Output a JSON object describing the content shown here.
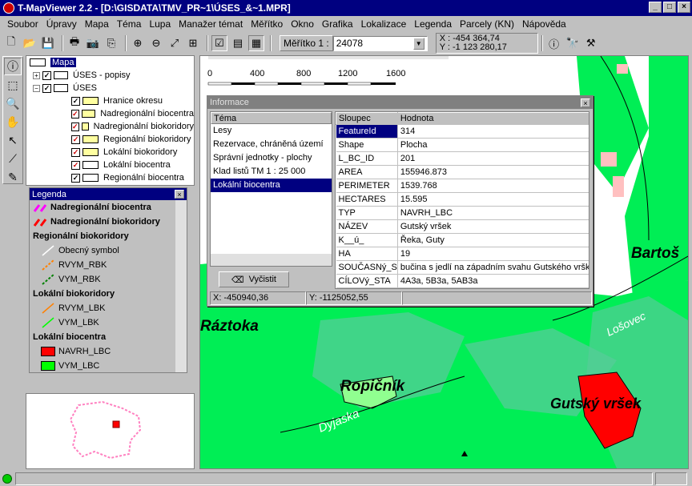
{
  "window": {
    "title": "T-MapViewer 2.2 - [D:\\GISDATA\\TMV_PR~1\\ÚSES_&~1.MPR]"
  },
  "menu": [
    "Soubor",
    "Úpravy",
    "Mapa",
    "Téma",
    "Lupa",
    "Manažer témat",
    "Měřítko",
    "Okno",
    "Grafika",
    "Lokalizace",
    "Legenda",
    "Parcely (KN)",
    "Nápověda"
  ],
  "toolbar": {
    "scale_label": "Měřítko 1 :",
    "scale_value": "24078",
    "coord_x": "X : -454 364,74",
    "coord_y": "Y : -1 123 280,17"
  },
  "tree": {
    "root": "Mapa",
    "groups": [
      "ÚSES - popisy",
      "ÚSES"
    ],
    "layers": [
      "Hranice okresu",
      "Nadregionální biocentra",
      "Nadregionální biokoridory",
      "Regionální biokoridory",
      "Lokální biokoridory",
      "Lokální biocentra",
      "Regionální biocentra"
    ]
  },
  "legend": {
    "title": "Legenda",
    "items": [
      {
        "label": "Nadregionální biocentra",
        "kind": "heading",
        "color": "#ff00ff"
      },
      {
        "label": "Nadregionální biokoridory",
        "kind": "heading",
        "color": "#ff0000"
      },
      {
        "label": "Regionální biokoridory",
        "kind": "group"
      },
      {
        "label": "Obecný symbol",
        "kind": "line",
        "color": "#ffffff"
      },
      {
        "label": "RVYM_RBK",
        "kind": "line",
        "color": "#ff8000"
      },
      {
        "label": "VYM_RBK",
        "kind": "line",
        "color": "#008000"
      },
      {
        "label": "Lokální biokoridory",
        "kind": "group"
      },
      {
        "label": "RVYM_LBK",
        "kind": "line",
        "color": "#ff8000"
      },
      {
        "label": "VYM_LBK",
        "kind": "line",
        "color": "#00ff00"
      },
      {
        "label": "Lokální biocentra",
        "kind": "group"
      },
      {
        "label": "NAVRH_LBC",
        "kind": "fill",
        "color": "#ff0000"
      },
      {
        "label": "VYM_LBC",
        "kind": "fill",
        "color": "#00ff00"
      }
    ]
  },
  "map": {
    "scalebar": [
      "0",
      "400",
      "800",
      "1200",
      "1600"
    ],
    "labels": {
      "raztoka": "Ráztoka",
      "ropicnik": "Ropičník",
      "gutsky": "Gutský vršek",
      "bartos": "Bartoš",
      "dyjaska": "Dyjaska",
      "losovec": "Lošovec"
    }
  },
  "info": {
    "title": "Informace",
    "theme_header": "Téma",
    "themes": [
      "Lesy",
      "Rezervace, chráněná území",
      "Správní jednotky - plochy",
      "Klad listů TM 1 : 25 000",
      "Lokální biocentra"
    ],
    "selected_theme": "Lokální biocentra",
    "clear_label": "Vyčistit",
    "col_field": "Sloupec",
    "col_value": "Hodnota",
    "rows": [
      {
        "k": "FeatureId",
        "v": "314"
      },
      {
        "k": "Shape",
        "v": "Plocha"
      },
      {
        "k": "L_BC_ID",
        "v": "201"
      },
      {
        "k": "AREA",
        "v": "155946.873"
      },
      {
        "k": "PERIMETER",
        "v": "1539.768"
      },
      {
        "k": "HECTARES",
        "v": "15.595"
      },
      {
        "k": "TYP",
        "v": "NAVRH_LBC"
      },
      {
        "k": "NÁZEV",
        "v": "Gutský vršek"
      },
      {
        "k": "K__ú_",
        "v": "Řeka, Guty"
      },
      {
        "k": "HA",
        "v": "19"
      },
      {
        "k": "SOUČASNý_S",
        "v": "bučina s jedlí na západním svahu Gutského vršku"
      },
      {
        "k": "CÍLOVý_STA",
        "v": "4A3a, 5B3a, 5AB3a"
      }
    ],
    "status_x": "X: -450940,36",
    "status_y": "Y: -1125052,55"
  }
}
